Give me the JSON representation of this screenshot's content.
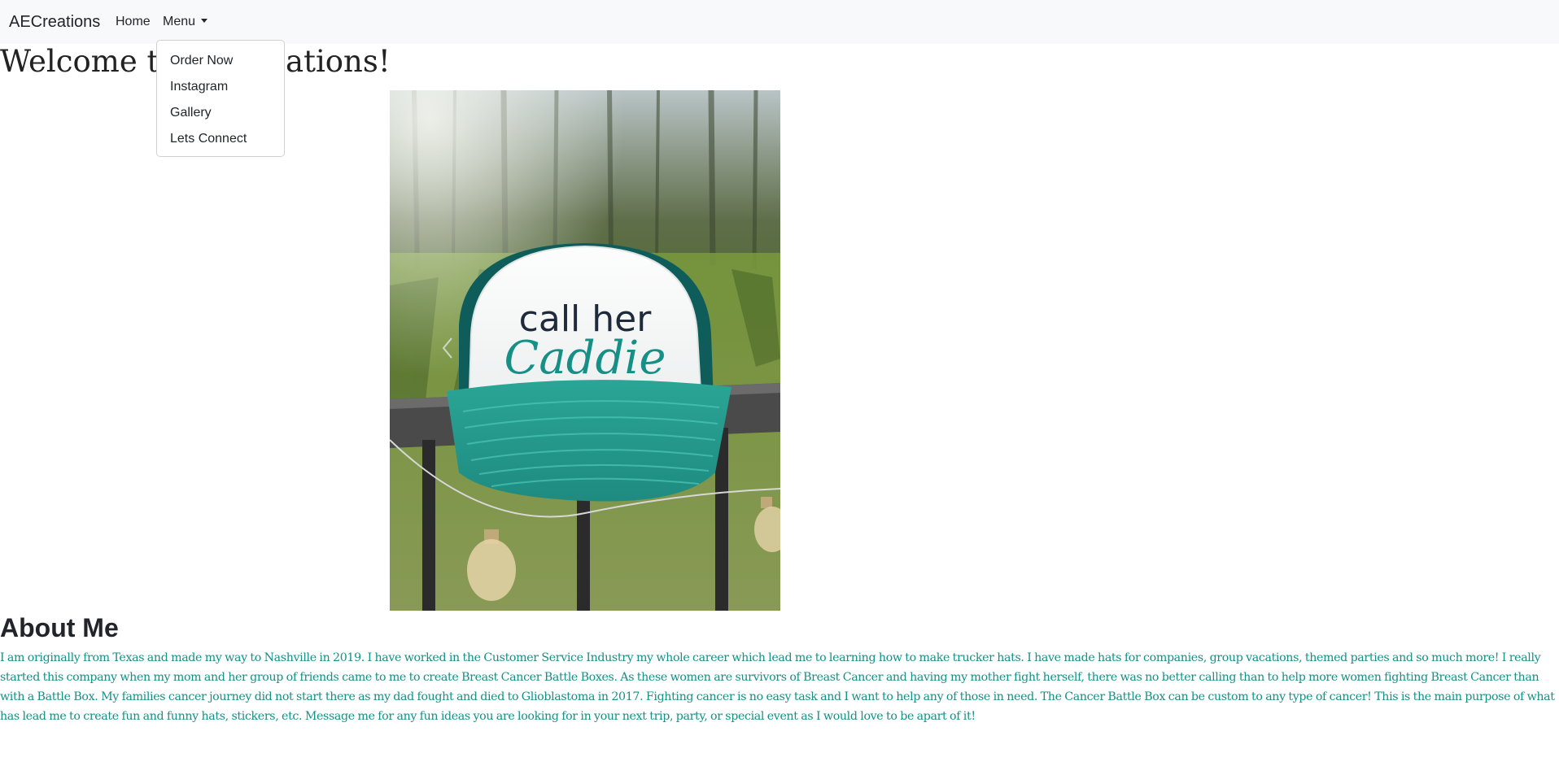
{
  "navbar": {
    "brand": "AECreations",
    "home_label": "Home",
    "menu_label": "Menu",
    "dropdown_items": [
      "Order Now",
      "Instagram",
      "Gallery",
      "Lets Connect"
    ]
  },
  "hero": {
    "welcome_text": "Welcome to AECreations!"
  },
  "carousel": {
    "slide_text_line1": "call her",
    "slide_text_line2": "Caddie",
    "prev_icon": "chevron-left-icon"
  },
  "about": {
    "title": "About Me",
    "text": "I am originally from Texas and made my way to Nashville in 2019. I have worked in the Customer Service Industry my whole career which lead me to learning how to make trucker hats. I have made hats for companies, group vacations, themed parties and so much more! I really started this company when my mom and her group of friends came to me to create Breast Cancer Battle Boxes. As these women are survivors of Breast Cancer and having my mother fight herself, there was no better calling than to help more women fighting Breast Cancer than with a Battle Box. My families cancer journey did not start there as my dad fought and died to Glioblastoma in 2017. Fighting cancer is no easy task and I want to help any of those in need. The Cancer Battle Box can be custom to any type of cancer! This is the main purpose of what has lead me to create fun and funny hats, stickers, etc. Message me for any fun ideas you are looking for in your next trip, party, or special event as I would love to be apart of it!"
  },
  "colors": {
    "navbar_bg": "#f8f9fa",
    "about_text": "#168f86",
    "hat_teal": "#1a9a8e"
  }
}
